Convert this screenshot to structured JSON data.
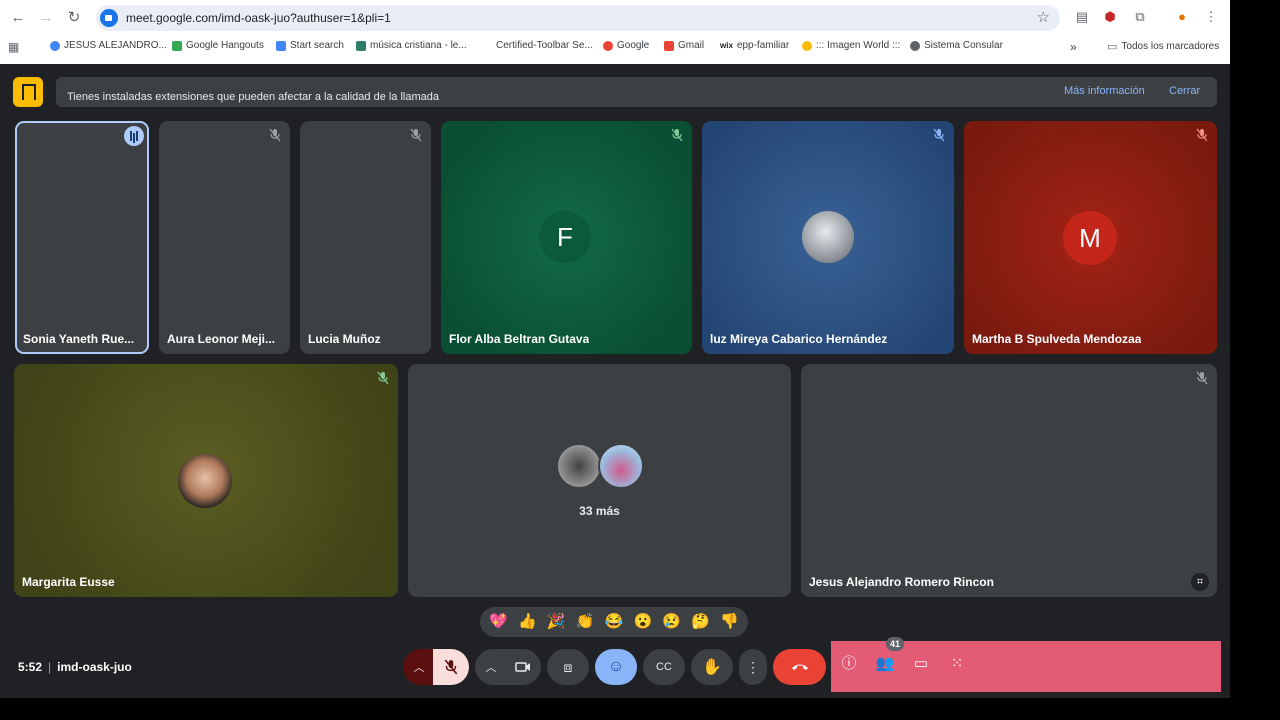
{
  "browser": {
    "url": "meet.google.com/imd-oask-juo?authuser=1&pli=1",
    "bookmarks": [
      {
        "label": "JESUS ALEJANDRO...",
        "color": "#4285f4"
      },
      {
        "label": "Google Hangouts",
        "color": "#34a853"
      },
      {
        "label": "Start search",
        "color": "#4285f4"
      },
      {
        "label": "música cristiana - le...",
        "color": "#2e7d6a"
      },
      {
        "label": "Certified-Toolbar Se...",
        "color": "#ffffff"
      },
      {
        "label": "Google",
        "color": "#ea4335"
      },
      {
        "label": "Gmail",
        "color": "#ea4335"
      },
      {
        "label": "epp-familiar",
        "color": "#222222"
      },
      {
        "label": "::: Imagen World :::",
        "color": "#fbbc04"
      },
      {
        "label": "Sistema Consular",
        "color": "#5f6368"
      }
    ],
    "all_bookmarks": "Todos los marcadores",
    "more_chevron": "»"
  },
  "notice": {
    "text": "Tienes instaladas extensiones que pueden afectar a la calidad de la llamada",
    "more_info": "Más información",
    "close": "Cerrar"
  },
  "participants_top": [
    {
      "name": "Sonia Yaneth Rue...",
      "bg": "#3c4043"
    },
    {
      "name": "Aura Leonor Meji...",
      "bg": "#3c4043"
    },
    {
      "name": "Lucia Muñoz",
      "bg": "#3c4043"
    },
    {
      "name": "Flor Alba Beltran Gutava",
      "bg": "#0d5c3b",
      "initial": "F",
      "avatar_color": "#0b5a3a"
    },
    {
      "name": "luz Mireya Cabarico Hernández",
      "bg": "#2b4f7e"
    },
    {
      "name": "Martha B Spulveda Mendozaa",
      "bg": "#8c1d10",
      "initial": "M",
      "avatar_color": "#c5261a"
    }
  ],
  "participants_bottom": [
    {
      "name": "Margarita Eusse",
      "bg": "#4c4f1e"
    },
    {
      "name": "",
      "bg": "#3c4043",
      "more": "33 más"
    },
    {
      "name": "Jesus Alejandro Romero Rincon",
      "bg": "#3c4043"
    }
  ],
  "reactions": [
    "💖",
    "👍",
    "🎉",
    "👏",
    "😂",
    "😮",
    "😢",
    "🤔",
    "👎"
  ],
  "meeting": {
    "time": "5:52",
    "code": "imd-oask-juo",
    "participant_count": "41"
  },
  "colors": {
    "meet_bg": "#202124",
    "tile_bg": "#3c4043",
    "end_call": "#ea4335",
    "accent_blue": "#8ab4f8",
    "panel_pink": "#e35b75"
  }
}
